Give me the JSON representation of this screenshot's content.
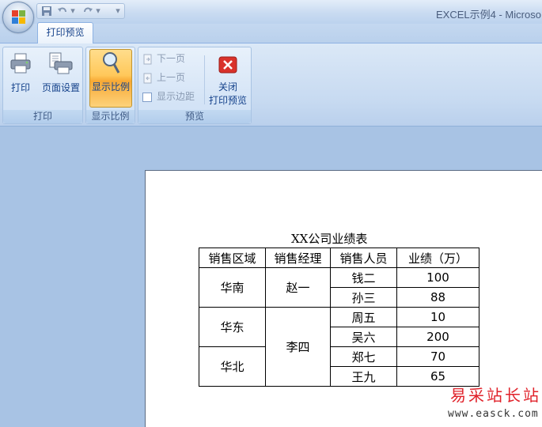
{
  "window": {
    "title": "EXCEL示例4 - Microso"
  },
  "quick_access": {
    "undo_arrow": "▾",
    "redo_arrow": "▾",
    "customize": "▾"
  },
  "tabs": [
    {
      "label": "打印预览",
      "active": true
    }
  ],
  "ribbon": {
    "print_group": {
      "label": "打印",
      "print_button": "打印",
      "page_setup_button": "页面设置"
    },
    "zoom_group": {
      "label": "显示比例",
      "zoom_button": "显示比例"
    },
    "preview_group": {
      "label": "预览",
      "next_page": "下一页",
      "prev_page": "上一页",
      "show_margins": "显示边距",
      "show_margins_checked": false,
      "close_line1": "关闭",
      "close_line2": "打印预览"
    }
  },
  "sheet": {
    "title": "XX公司业绩表",
    "headers": [
      "销售区域",
      "销售经理",
      "销售人员",
      "业绩（万）"
    ],
    "regions": [
      "华南",
      "华东",
      "华北"
    ],
    "managers": [
      "赵一",
      "李四"
    ],
    "rows": [
      {
        "person": "钱二",
        "value": "100"
      },
      {
        "person": "孙三",
        "value": "88"
      },
      {
        "person": "周五",
        "value": "10"
      },
      {
        "person": "吴六",
        "value": "200"
      },
      {
        "person": "郑七",
        "value": "70"
      },
      {
        "person": "王九",
        "value": "65"
      }
    ]
  },
  "watermark": {
    "site": "易采站长站",
    "url": "www.easck.com"
  },
  "colors": {
    "accent": "#15428b",
    "active_button": "#ffc85a",
    "close_red": "#d9322b"
  }
}
